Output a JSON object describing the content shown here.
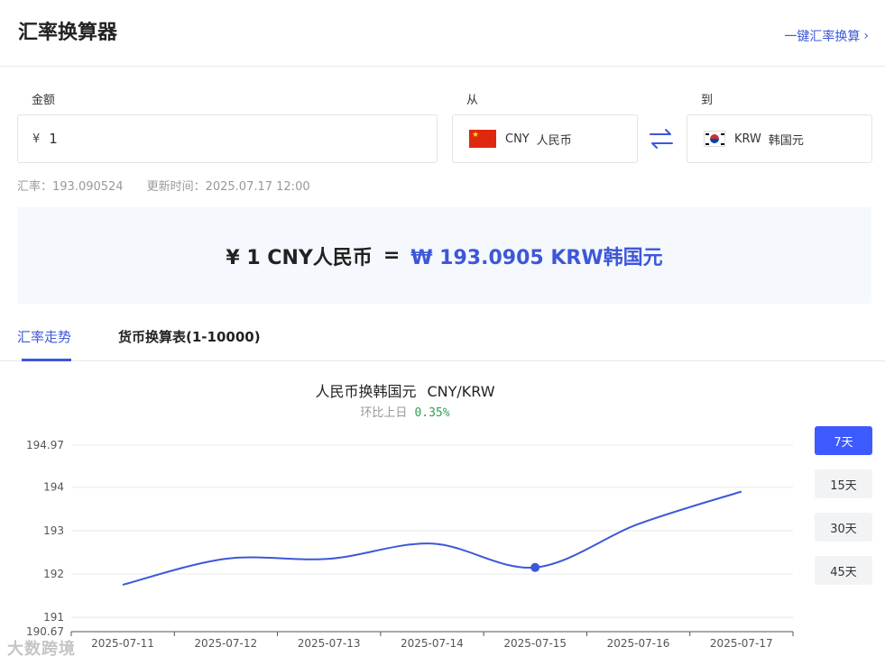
{
  "header": {
    "title": "汇率换算器",
    "one_key_label": "一键汇率换算"
  },
  "form": {
    "amount_label": "金额",
    "amount_symbol": "¥",
    "amount_value": "1",
    "from_label": "从",
    "to_label": "到",
    "from_code": "CNY",
    "from_name": "人民币",
    "to_code": "KRW",
    "to_name": "韩国元"
  },
  "rate_info": {
    "rate": "汇率：193.090524",
    "updated": "更新时间：2025.07.17 12:00"
  },
  "result": {
    "from_text": "¥ 1 CNY人民币",
    "equals": "=",
    "to_text": "₩ 193.0905 KRW韩国元"
  },
  "tabs": [
    {
      "label": "汇率走势"
    },
    {
      "label": "货币换算表(1-10000)"
    }
  ],
  "chart_header": {
    "title": "人民币换韩国元",
    "pair": "CNY/KRW",
    "change_label": "环比上日",
    "change_value": "0.35%"
  },
  "ranges": [
    {
      "label": "7天"
    },
    {
      "label": "15天"
    },
    {
      "label": "30天"
    },
    {
      "label": "45天"
    }
  ],
  "watermark": "大数跨境",
  "colors": {
    "accent": "#3d57d8",
    "button_active": "#3d5afe",
    "positive": "#2fa153",
    "line": "#3d57d8"
  },
  "chart_data": {
    "type": "line",
    "title": "人民币换韩国元 CNY/KRW",
    "x": [
      "2025-07-11",
      "2025-07-12",
      "2025-07-13",
      "2025-07-14",
      "2025-07-15",
      "2025-07-16",
      "2025-07-17"
    ],
    "series": [
      {
        "values": [
          191.75,
          192.35,
          192.35,
          192.7,
          192.15,
          193.15,
          193.9
        ]
      }
    ],
    "y_ticks": [
      190.67,
      191,
      192,
      193,
      194,
      194.97
    ],
    "ylim": [
      190.67,
      194.97
    ],
    "grid": true,
    "highlight_index": 4
  }
}
